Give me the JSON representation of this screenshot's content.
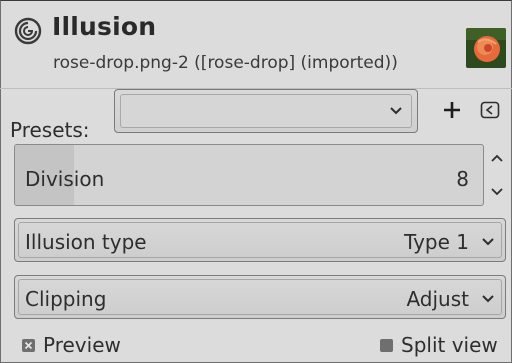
{
  "header": {
    "title": "Illusion",
    "subtitle": "rose-drop.png-2 ([rose-drop] (imported))",
    "logo_icon": "gimp-swirl-icon",
    "thumbnail": "rose-thumbnail"
  },
  "presets": {
    "label": "Presets:",
    "value": "",
    "dropdown_icon": "chevron-down-icon",
    "add_icon": "plus-icon",
    "reset_icon": "reset-icon"
  },
  "division": {
    "label": "Division",
    "value": "8",
    "fill_fraction": 0.125
  },
  "illusion_type": {
    "label": "Illusion type",
    "value": "Type 1"
  },
  "clipping": {
    "label": "Clipping",
    "value": "Adjust"
  },
  "preview": {
    "label": "Preview",
    "checked": true
  },
  "split_view": {
    "label": "Split view",
    "checked": false
  },
  "colors": {
    "background": "#dcdcdc",
    "text": "#2e2e2e",
    "checkbox": "#6f6f6f"
  }
}
